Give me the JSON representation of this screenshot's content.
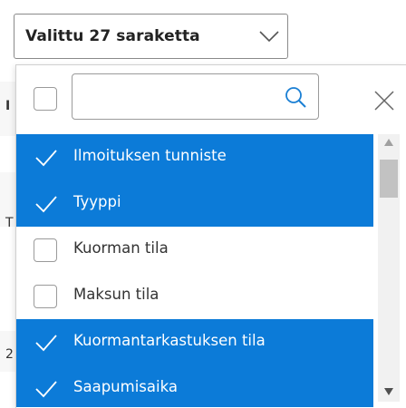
{
  "select": {
    "label": "Valittu 27 saraketta"
  },
  "search": {
    "placeholder": "",
    "value": ""
  },
  "background_fragments": [
    "I",
    "T",
    "2"
  ],
  "options": [
    {
      "label": "Ilmoituksen tunniste",
      "selected": true
    },
    {
      "label": "Tyyppi",
      "selected": true
    },
    {
      "label": "Kuorman tila",
      "selected": false
    },
    {
      "label": "Maksun tila",
      "selected": false
    },
    {
      "label": "Kuormantarkastuksen tila",
      "selected": true
    },
    {
      "label": "Saapumisaika",
      "selected": true
    }
  ],
  "colors": {
    "selected_bg": "#0c7bd8",
    "selected_text": "#ffffff",
    "unselected_text": "#333333",
    "border": "#9a9a9a"
  },
  "icons": {
    "dropdown": "chevron-down-icon",
    "search": "search-icon",
    "close": "close-icon",
    "check": "checkmark-icon"
  }
}
